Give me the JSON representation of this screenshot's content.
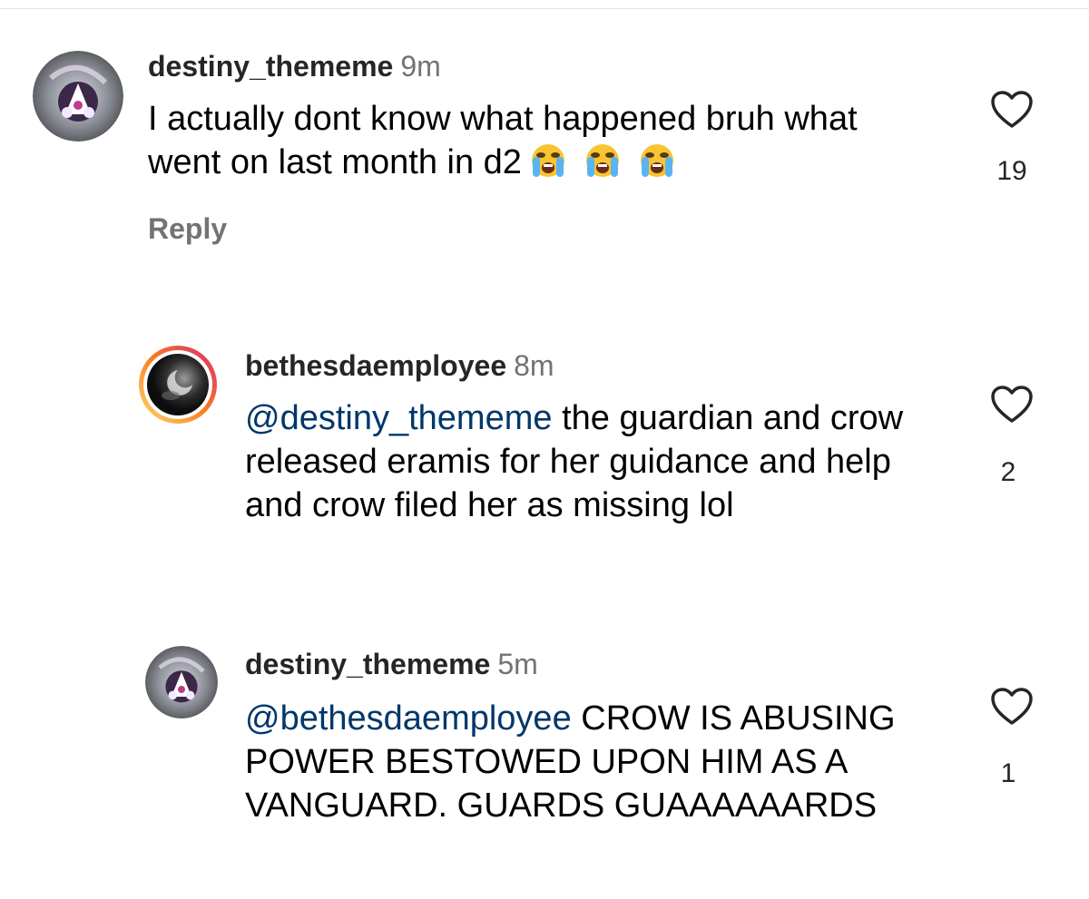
{
  "comments": [
    {
      "username": "destiny_thememe",
      "time": "9m",
      "text": "I actually dont know what happened bruh what went on last month in d2",
      "emojis": [
        "loudly-crying-face",
        "loudly-crying-face",
        "loudly-crying-face"
      ],
      "likes": "19",
      "reply_label": "Reply"
    },
    {
      "username": "bethesdaemployee",
      "time": "8m",
      "mention": "@destiny_thememe",
      "text": "the guardian and crow released eramis for her guidance and help and crow filed her as missing lol",
      "likes": "2"
    },
    {
      "username": "destiny_thememe",
      "time": "5m",
      "mention": "@bethesdaemployee",
      "text": "CROW IS ABUSING POWER BESTOWED UPON HIM AS A VANGUARD. GUARDS GUAAAAAARDS",
      "likes": "1"
    }
  ],
  "icons": {
    "like": "heart-outline-icon",
    "avatar_1": "ghost-shell-avatar",
    "avatar_2": "dark-moon-avatar"
  },
  "colors": {
    "mention": "#00376b",
    "secondary_text": "#737373",
    "story_ring_start": "#feda75",
    "story_ring_end": "#d62976"
  }
}
